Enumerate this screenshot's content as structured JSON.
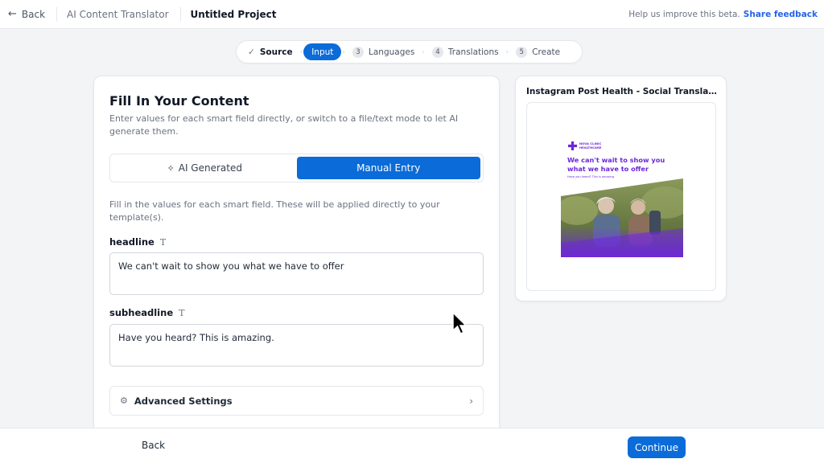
{
  "topbar": {
    "back_label": "Back",
    "app_name": "AI Content Translator",
    "project_name": "Untitled Project",
    "feedback_prompt": "Help us improve this beta.",
    "feedback_link": "Share feedback"
  },
  "stepper": {
    "steps": [
      {
        "label": "Source",
        "state": "done",
        "number": ""
      },
      {
        "label": "Input",
        "state": "active",
        "number": ""
      },
      {
        "label": "Languages",
        "state": "pending",
        "number": "3"
      },
      {
        "label": "Translations",
        "state": "pending",
        "number": "4"
      },
      {
        "label": "Create",
        "state": "pending",
        "number": "5"
      }
    ]
  },
  "content": {
    "title": "Fill In Your Content",
    "description": "Enter values for each smart field directly, or switch to a file/text mode to let AI generate them.",
    "modes": {
      "ai_label": "AI Generated",
      "manual_label": "Manual Entry",
      "selected": "Manual Entry"
    },
    "hint": "Fill in the values for each smart field. These will be applied directly to your template(s).",
    "fields": [
      {
        "label": "headline",
        "type_icon": "T",
        "value": "We can't wait to show you what we have to offer"
      },
      {
        "label": "subheadline",
        "type_icon": "T",
        "value": "Have you heard? This is amazing."
      }
    ],
    "advanced_label": "Advanced Settings"
  },
  "preview": {
    "title": "Instagram Post Health - Social Translate Exam...",
    "post": {
      "brand_line1": "NOVA CLINIC",
      "brand_line2": "HEALTHCARE",
      "headline": "We can't wait to show you what we have to offer",
      "subheadline": "Have you heard? This is amazing."
    }
  },
  "footer": {
    "back_label": "Back",
    "continue_label": "Continue"
  },
  "colors": {
    "primary": "#0b6bd8",
    "brand_purple": "#6d28d9",
    "link": "#2563eb"
  }
}
